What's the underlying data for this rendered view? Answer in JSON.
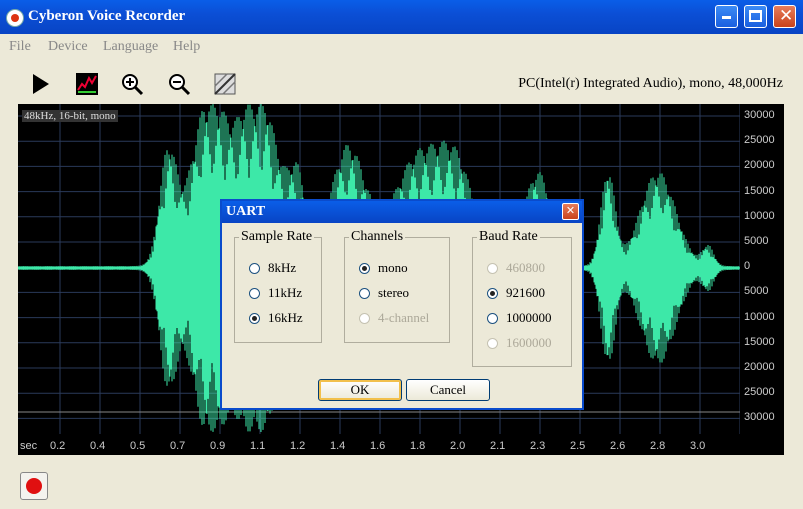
{
  "window": {
    "title": "Cyberon Voice Recorder",
    "controls": {
      "minimize_icon": "minimize-icon",
      "maximize_icon": "maximize-icon",
      "close_icon": "close-icon"
    }
  },
  "menu": [
    "File",
    "Device",
    "Language",
    "Help"
  ],
  "toolbar": {
    "buttons": [
      "play-icon",
      "spectrum-icon",
      "zoom-in-icon",
      "zoom-out-icon",
      "fit-icon"
    ],
    "device_info": "PC(Intel(r) Integrated Audio), mono, 48,000Hz"
  },
  "waveform": {
    "format_label": "48kHz, 16-bit, mono",
    "color": "#3de8a8",
    "y_ticks": [
      "30000",
      "25000",
      "20000",
      "15000",
      "10000",
      "5000",
      "0",
      "5000",
      "10000",
      "15000",
      "20000",
      "25000",
      "30000"
    ],
    "x_unit": "sec",
    "x_ticks": [
      "0.2",
      "0.4",
      "0.5",
      "0.7",
      "0.9",
      "1.1",
      "1.2",
      "1.4",
      "1.6",
      "1.8",
      "2.0",
      "2.1",
      "2.3",
      "2.5",
      "2.6",
      "2.8",
      "3.0"
    ]
  },
  "dialog": {
    "title": "UART",
    "close_icon": "close-icon",
    "sample_rate": {
      "label": "Sample Rate",
      "options": [
        {
          "label": "8kHz",
          "selected": false
        },
        {
          "label": "11kHz",
          "selected": false
        },
        {
          "label": "16kHz",
          "selected": true
        }
      ]
    },
    "channels": {
      "label": "Channels",
      "options": [
        {
          "label": "mono",
          "selected": true
        },
        {
          "label": "stereo",
          "selected": false
        },
        {
          "label": "4-channel",
          "selected": false,
          "disabled": true
        }
      ]
    },
    "baud_rate": {
      "label": "Baud Rate",
      "options": [
        {
          "label": "460800",
          "selected": false,
          "disabled": true
        },
        {
          "label": "921600",
          "selected": true
        },
        {
          "label": "1000000",
          "selected": false
        },
        {
          "label": "1600000",
          "selected": false,
          "disabled": true
        }
      ]
    },
    "ok_label": "OK",
    "cancel_label": "Cancel"
  },
  "record_button": {
    "icon": "record-icon"
  }
}
